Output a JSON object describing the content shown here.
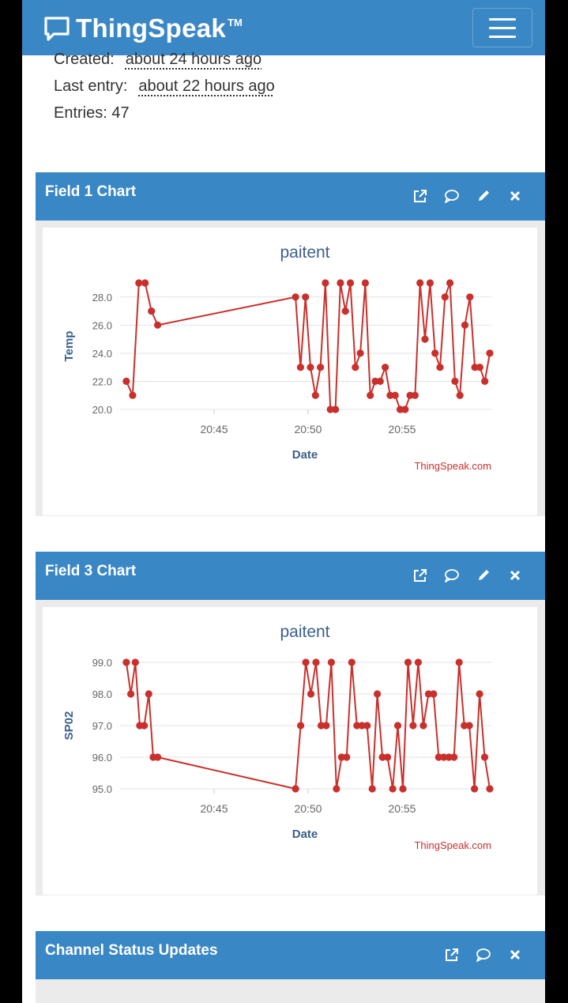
{
  "app": {
    "name": "ThingSpeak",
    "trademark": "TM"
  },
  "channel_info": {
    "created_label": "Created:",
    "created_value": "about 24 hours ago",
    "last_entry_label": "Last entry:",
    "last_entry_value": "about 22 hours ago",
    "entries_text": "Entries: 47"
  },
  "panels": {
    "field1": {
      "title": "Field 1 Chart",
      "icons": [
        "external-link-icon",
        "comment-icon",
        "pencil-icon",
        "close-icon"
      ]
    },
    "field3": {
      "title": "Field 3 Chart",
      "icons": [
        "external-link-icon",
        "comment-icon",
        "pencil-icon",
        "close-icon"
      ]
    },
    "status": {
      "title": "Channel Status Updates",
      "icons": [
        "external-link-icon",
        "comment-icon",
        "close-icon"
      ]
    }
  },
  "colors": {
    "header": "#3a87c6",
    "series": "#c9302c",
    "axis_label": "#3a5f8c",
    "credit": "#c9302c"
  },
  "chart_data": [
    {
      "type": "line",
      "title": "paitent",
      "xlabel": "Date",
      "ylabel": "Temp",
      "credit": "ThingSpeak.com",
      "x_ticks": [
        "20:45",
        "20:50",
        "20:55"
      ],
      "y_ticks": [
        "20.0",
        "22.0",
        "24.0",
        "26.0",
        "28.0"
      ],
      "ylim": [
        20,
        29
      ],
      "grid": true,
      "series": [
        {
          "time": [
            "20:40:00",
            "20:40:20",
            "20:40:40",
            "20:41:00",
            "20:41:20",
            "20:41:40",
            "20:42:00",
            "20:42:20",
            "20:49:20",
            "20:49:40",
            "20:50:00",
            "20:50:20",
            "20:50:40",
            "20:51:00",
            "20:51:20",
            "20:51:40",
            "20:52:00",
            "20:52:20",
            "20:52:40",
            "20:53:00",
            "20:53:20",
            "20:53:40",
            "20:54:00",
            "20:54:20",
            "20:54:40",
            "20:55:00",
            "20:55:20",
            "20:55:40",
            "20:56:00",
            "20:56:20",
            "20:56:40",
            "20:57:00",
            "20:57:20",
            "20:57:40",
            "20:58:00",
            "20:58:20",
            "20:58:40",
            "20:59:00",
            "20:59:20",
            "20:59:40"
          ],
          "values": [
            22,
            21,
            29,
            29,
            27,
            26,
            28,
            23,
            28,
            23,
            21,
            23,
            29,
            20,
            20,
            29,
            27,
            29,
            23,
            24,
            29,
            21,
            22,
            22,
            23,
            21,
            21,
            20,
            20,
            21,
            21,
            29,
            25,
            29,
            24,
            23,
            28,
            29,
            22,
            21,
            26,
            28,
            23,
            23,
            22,
            24
          ]
        }
      ]
    },
    {
      "type": "line",
      "title": "paitent",
      "xlabel": "Date",
      "ylabel": "SP02",
      "credit": "ThingSpeak.com",
      "x_ticks": [
        "20:45",
        "20:50",
        "20:55"
      ],
      "y_ticks": [
        "95.0",
        "96.0",
        "97.0",
        "98.0",
        "99.0"
      ],
      "ylim": [
        95,
        99
      ],
      "grid": true,
      "series": [
        {
          "values": [
            99,
            98,
            99,
            97,
            97,
            98,
            96,
            96,
            95,
            97,
            99,
            98,
            99,
            97,
            97,
            99,
            95,
            96,
            96,
            99,
            97,
            97,
            97,
            95,
            98,
            96,
            96,
            95,
            97,
            95,
            99,
            97,
            99,
            97,
            98,
            98,
            96,
            96,
            96,
            96,
            99,
            97,
            97,
            95,
            98,
            96,
            95
          ]
        }
      ]
    }
  ]
}
